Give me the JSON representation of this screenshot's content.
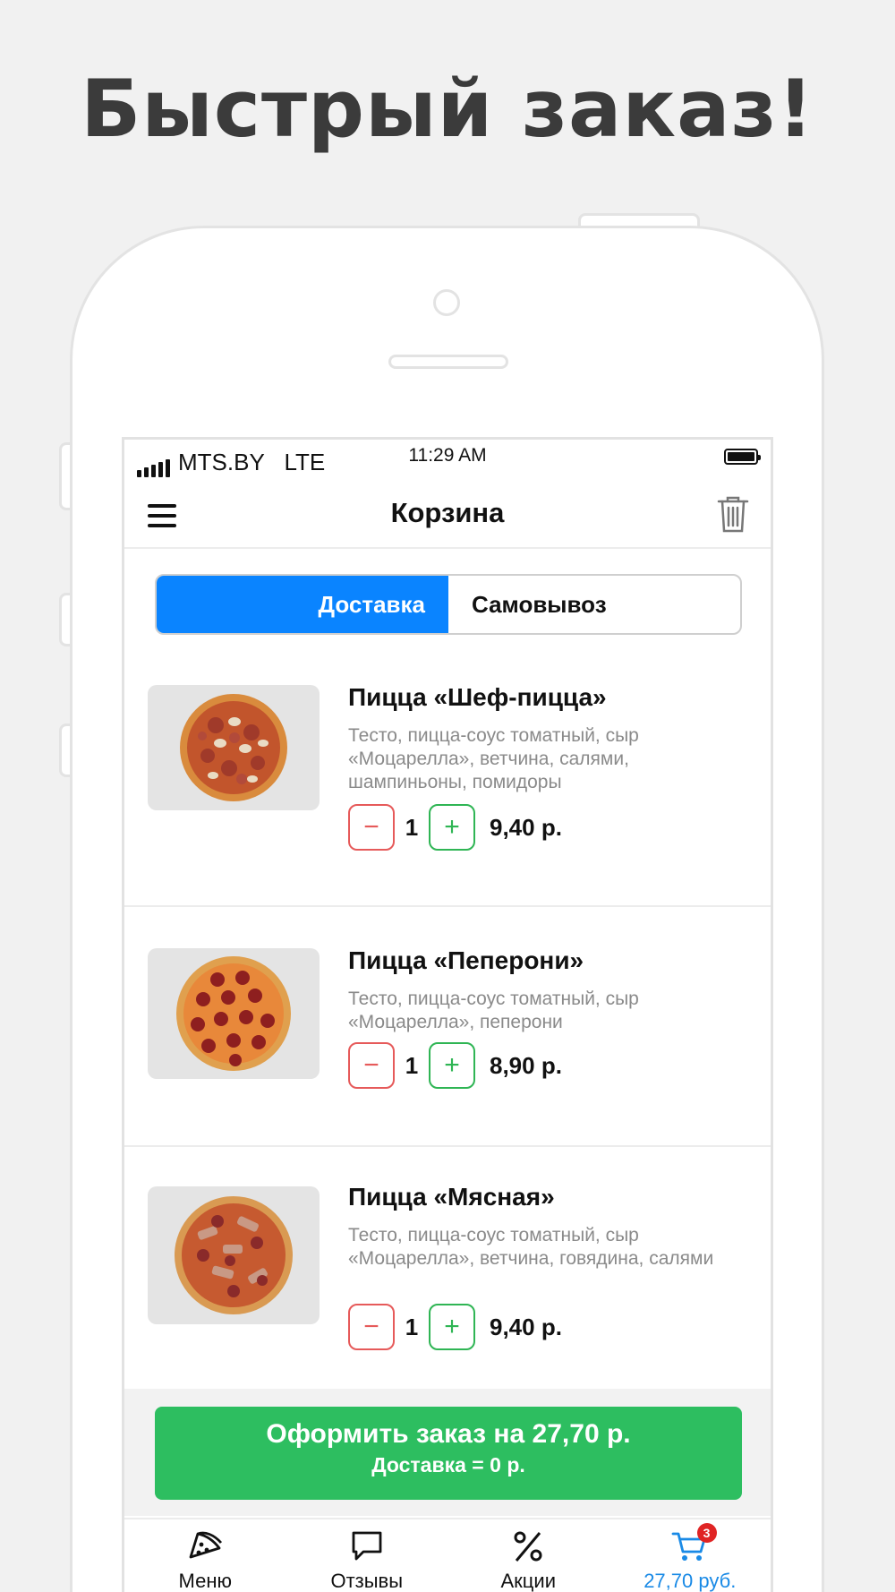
{
  "headline": "Быстрый заказ!",
  "status_bar": {
    "carrier": "MTS.BY",
    "network": "LTE",
    "time": "11:29 AM"
  },
  "navbar": {
    "title": "Корзина"
  },
  "delivery_toggle": {
    "active": "Доставка",
    "inactive": "Самовывоз",
    "active_color": "#0a84ff"
  },
  "cart_items": [
    {
      "title": "Пицца «Шеф-пицца»",
      "description": "Тесто, пицца-соус томатный, сыр «Моцарелла», ветчина, салями, шампиньоны, помидоры",
      "quantity": "1",
      "price": "9,40 р.",
      "minus": "−",
      "plus": "+"
    },
    {
      "title": "Пицца «Пеперони»",
      "description": "Тесто, пицца-соус томатный, сыр «Моцарелла», пеперони",
      "quantity": "1",
      "price": "8,90 р.",
      "minus": "−",
      "plus": "+"
    },
    {
      "title": "Пицца «Мясная»",
      "description": "Тесто, пицца-соус томатный, сыр «Моцарелла», ветчина, говядина, салями",
      "quantity": "1",
      "price": "9,40 р.",
      "minus": "−",
      "plus": "+"
    }
  ],
  "checkout": {
    "line1": "Оформить заказ на 27,70 р.",
    "line2": "Доставка = 0 р.",
    "color": "#2dbe60"
  },
  "tabbar": {
    "tabs": [
      {
        "label": "Меню",
        "icon": "pizza-slice-icon"
      },
      {
        "label": "Отзывы",
        "icon": "speech-bubble-icon"
      },
      {
        "label": "Акции",
        "icon": "percent-icon"
      },
      {
        "label": "27,70 руб.",
        "icon": "cart-icon",
        "badge": "3"
      }
    ],
    "active_color": "#1a8ae6"
  }
}
